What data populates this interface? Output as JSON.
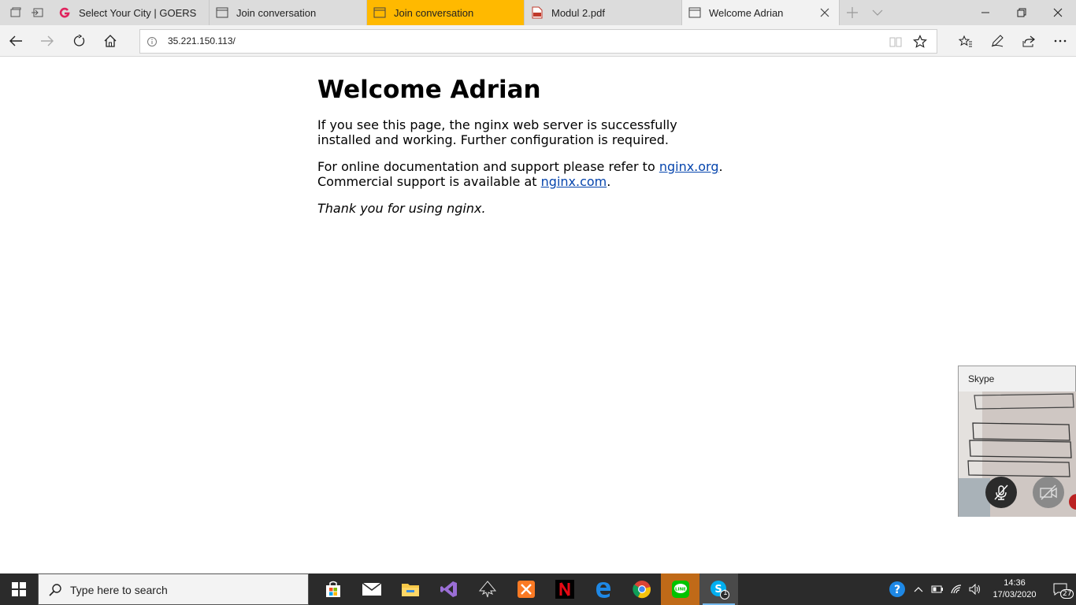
{
  "browser": {
    "tabs": [
      {
        "label": "Select Your City | GOERS",
        "icon": "goers-logo-icon",
        "state": "normal"
      },
      {
        "label": "Join conversation",
        "icon": "window-icon",
        "state": "normal"
      },
      {
        "label": "Join conversation",
        "icon": "window-icon",
        "state": "highlight"
      },
      {
        "label": "Modul 2.pdf",
        "icon": "pdf-icon",
        "state": "normal"
      },
      {
        "label": "Welcome Adrian",
        "icon": "window-icon",
        "state": "active"
      }
    ],
    "url": "35.221.150.113/",
    "colors": {
      "tab_bar": "#dcdcdc",
      "active_tab": "#f2f2f2",
      "highlight_tab": "#ffb900"
    }
  },
  "page": {
    "heading": "Welcome Adrian",
    "para1": "If you see this page, the nginx web server is successfully installed and working. Further configuration is required.",
    "para2_prefix": "For online documentation and support please refer to ",
    "link1": "nginx.org",
    "para2_mid": ".",
    "para2_line2": "Commercial support is available at ",
    "link2": "nginx.com",
    "para2_end": ".",
    "thanks": "Thank you for using nginx."
  },
  "skype": {
    "title": "Skype"
  },
  "taskbar": {
    "search_placeholder": "Type here to search",
    "apps": [
      "store-icon",
      "mail-icon",
      "file-explorer-icon",
      "visual-studio-icon",
      "inkscape-icon",
      "xampp-icon",
      "netflix-icon",
      "edge-icon",
      "chrome-icon",
      "line-icon",
      "skype-icon"
    ],
    "skype_badge": "1",
    "time": "14:36",
    "date": "17/03/2020",
    "notification_count": "27"
  }
}
